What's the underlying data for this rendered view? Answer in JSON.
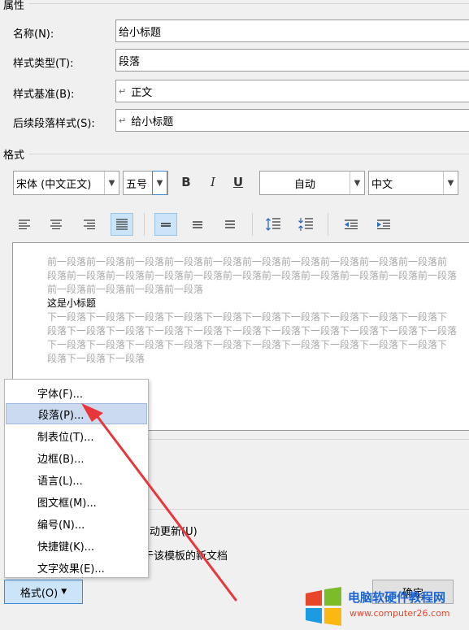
{
  "properties": {
    "section_title": "属性",
    "name_label": "名称(N):",
    "name_value": "给小标题",
    "type_label": "样式类型(T):",
    "type_value": "段落",
    "base_label": "样式基准(B):",
    "base_value": "正文",
    "next_label": "后续段落样式(S):",
    "next_value": "给小标题"
  },
  "format": {
    "section_title": "格式",
    "font": "宋体 (中文正文)",
    "size": "五号",
    "bold": "B",
    "italic": "I",
    "underline": "U",
    "color": "自动",
    "language": "中文"
  },
  "preview": {
    "prev_lines": [
      "前一段落前一段落前一段落前一段落前一段落前一段落前一段落前一段落前一段落前一段落前",
      "段落前一段落前一段落前一段落前一段落前一段落前一段落前一段落前一段落前一段落前一段落",
      "前一段落前一段落前一段落前一段落"
    ],
    "current_text": "这是小标题",
    "next_lines": [
      "下一段落下一段落下一段落下一段落下一段落下一段落下一段落下一段落下一段落下一段落下",
      "段落下一段落下一段落下一段落下一段落下一段落下一段落下一段落下一段落下一段落下一段落",
      "下一段落下一段落下一段落下一段落下一段落下一段落下一段落下一段落下一段落下一段落下",
      "段落下一段落下一段落"
    ]
  },
  "options": {
    "auto_update": "动更新(U)",
    "new_docs": "于该模板的新文档"
  },
  "menu": {
    "items": [
      "字体(F)...",
      "段落(P)...",
      "制表位(T)...",
      "边框(B)...",
      "语言(L)...",
      "图文框(M)...",
      "编号(N)...",
      "快捷键(K)...",
      "文字效果(E)..."
    ]
  },
  "buttons": {
    "format": "格式(O)",
    "ok": "确定"
  },
  "watermark": {
    "title": "电脑软硬件教程网",
    "url": "www.computer26.com"
  },
  "colors": {
    "selection": "#ccdaf0",
    "active_button": "#cce4f7",
    "arrow": "#e8363a"
  }
}
